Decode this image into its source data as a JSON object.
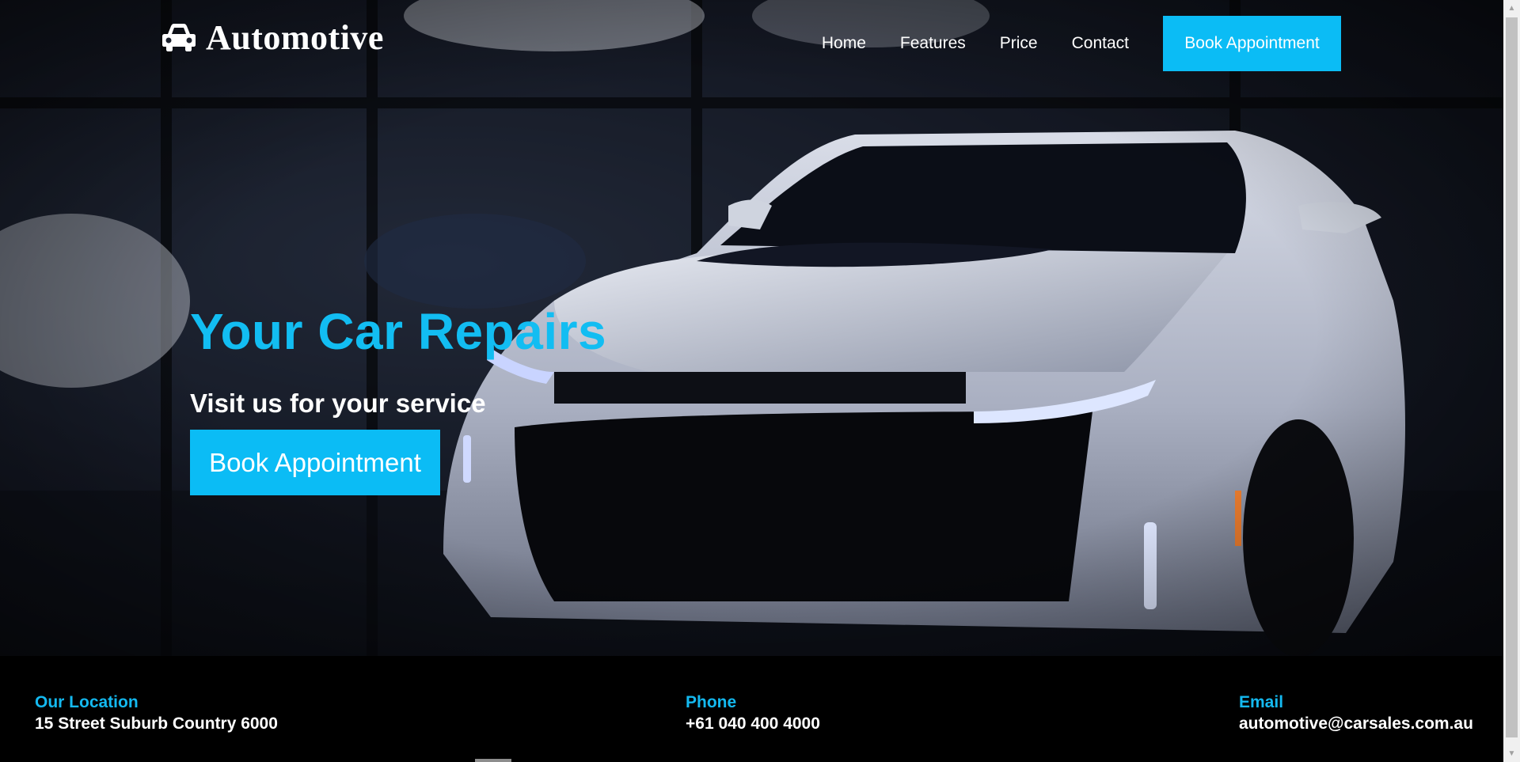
{
  "brand": {
    "name": "Automotive",
    "icon": "car-icon"
  },
  "nav": {
    "items": [
      {
        "label": "Home"
      },
      {
        "label": "Features"
      },
      {
        "label": "Price"
      },
      {
        "label": "Contact"
      }
    ],
    "cta_label": "Book Appointment"
  },
  "hero": {
    "title": "Your Car Repairs",
    "subtitle": "Visit us for your service",
    "button_label": "Book Appointment"
  },
  "footer": {
    "location": {
      "label": "Our Location",
      "value": "15 Street Suburb Country 6000"
    },
    "phone": {
      "label": "Phone",
      "value": "+61 040 400 4000"
    },
    "email": {
      "label": "Email",
      "value": "automotive@carsales.com.au"
    }
  },
  "colors": {
    "accent": "#0bbcf5",
    "footer_bg": "#000000",
    "text": "#ffffff"
  }
}
